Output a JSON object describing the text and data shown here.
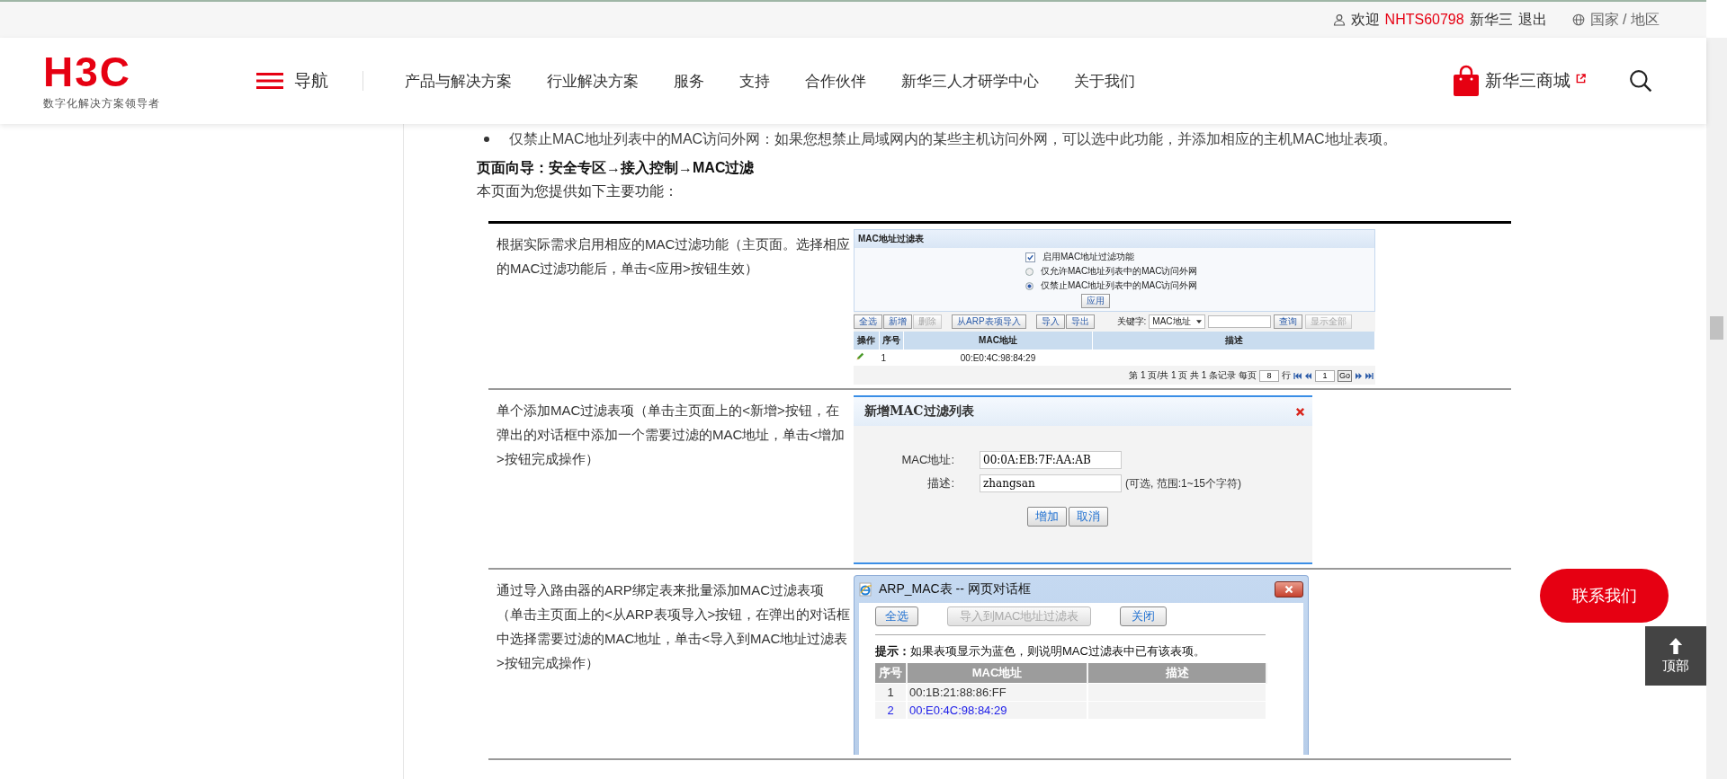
{
  "top_bar": {
    "greeting": "欢迎",
    "username": "NHTS60798",
    "company": "新华三",
    "logout": "退出",
    "region": "国家 / 地区"
  },
  "header": {
    "logo": "H3C",
    "tagline": "数字化解决方案领导者",
    "nav_toggle": "导航",
    "nav": [
      "产品与解决方案",
      "行业解决方案",
      "服务",
      "支持",
      "合作伙伴",
      "新华三人才研学中心",
      "关于我们"
    ],
    "store": "新华三商城"
  },
  "article": {
    "bullet": "仅禁止MAC地址列表中的MAC访问外网：如果您想禁止局域网内的某些主机访问外网，可以选中此功能，并添加相应的主机MAC地址表项。",
    "guide": "页面向导：安全专区→接入控制→MAC过滤",
    "intro": "本页面为您提供如下主要功能：",
    "features": [
      {
        "description": "根据实际需求启用相应的MAC过滤功能（主页面。选择相应的MAC过滤功能后，单击<应用>按钮生效）",
        "screenshot": {
          "kind": "filter_page",
          "title": "MAC地址过滤表",
          "options": [
            {
              "kind": "checkbox",
              "label": "启用MAC地址过滤功能",
              "checked": true
            },
            {
              "kind": "radio",
              "label": "仅允许MAC地址列表中的MAC访问外网",
              "selected": false
            },
            {
              "kind": "radio",
              "label": "仅禁止MAC地址列表中的MAC访问外网",
              "selected": true
            }
          ],
          "apply": "应用",
          "toolbar_groups": [
            {
              "buttons": [
                {
                  "label": "全选",
                  "disabled": false
                },
                {
                  "label": "新增",
                  "disabled": false
                },
                {
                  "label": "删除",
                  "disabled": true
                }
              ]
            },
            {
              "buttons": [
                {
                  "label": "从ARP表项导入",
                  "disabled": false
                }
              ]
            },
            {
              "buttons": [
                {
                  "label": "导入",
                  "disabled": false
                },
                {
                  "label": "导出",
                  "disabled": false
                }
              ]
            }
          ],
          "keyword_label": "关键字:",
          "keyword_select": "MAC地址",
          "query": {
            "label": "查询",
            "disabled": false
          },
          "show_all": {
            "label": "显示全部",
            "disabled": true
          },
          "columns": [
            "操作",
            "序号",
            "MAC地址",
            "描述"
          ],
          "rows": [
            {
              "index": "1",
              "mac": "00:E0:4C:98:84:29"
            }
          ],
          "pagination": {
            "summary": "第 1 页/共 1 页 共 1 条记录 每页",
            "per_page": "8",
            "rows_label": "行",
            "page": "1",
            "go": "Go"
          }
        }
      },
      {
        "description": "单个添加MAC过滤表项（单击主页面上的<新增>按钮，在弹出的对话框中添加一个需要过滤的MAC地址，单击<增加>按钮完成操作）",
        "screenshot": {
          "kind": "add_dialog",
          "title": "新增MAC过滤列表",
          "fields": [
            {
              "label": "MAC地址:",
              "value": "00:0A:EB:7F:AA:AB"
            },
            {
              "label": "描述:",
              "value": "zhangsan",
              "hint": "(可选, 范围:1~15个字符)"
            }
          ],
          "buttons": [
            "增加",
            "取消"
          ]
        }
      },
      {
        "description": "通过导入路由器的ARP绑定表来批量添加MAC过滤表项（单击主页面上的<从ARP表项导入>按钮，在弹出的对话框中选择需要过滤的MAC地址，单击<导入到MAC地址过滤表>按钮完成操作）",
        "screenshot": {
          "kind": "arp_dialog",
          "title": "ARP_MAC表 -- 网页对话框",
          "buttons": [
            {
              "label": "全选",
              "disabled": false
            },
            {
              "label": "导入到MAC地址过滤表",
              "disabled": true
            },
            {
              "label": "关闭",
              "disabled": false
            }
          ],
          "tip": "**提示：**如果表项显示为蓝色，则说明MAC过滤表中已有该表项。",
          "columns": [
            "序号",
            "MAC地址",
            "描述"
          ],
          "rows": [
            {
              "index": "1",
              "mac": "00:1B:21:88:86:FF",
              "in_filter": false
            },
            {
              "index": "2",
              "mac": "00:E0:4C:98:84:29",
              "in_filter": true
            }
          ]
        }
      }
    ]
  },
  "contact": "联系我们",
  "back_to_top": "顶部"
}
